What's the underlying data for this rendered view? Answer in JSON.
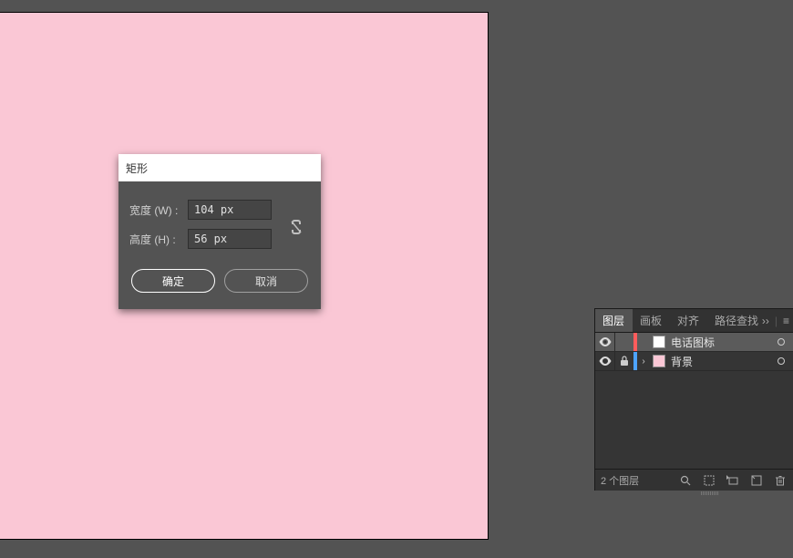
{
  "canvas": {
    "fill": "#fac7d5"
  },
  "dialog": {
    "title": "矩形",
    "width_label": "宽度 (W) :",
    "width_value": "104 px",
    "height_label": "高度 (H) :",
    "height_value": "56 px",
    "ok_label": "确定",
    "cancel_label": "取消"
  },
  "panel": {
    "tabs": [
      "图层",
      "画板",
      "对齐",
      "路径查找"
    ],
    "active_tab": 0,
    "more_glyph": "››",
    "menu_glyph": "≡",
    "layers": [
      {
        "name": "电话图标",
        "color_bar": "#ff5c5c",
        "swatch": "#ffffff",
        "visible": true,
        "locked": false,
        "selected": true,
        "expandable": false
      },
      {
        "name": "背景",
        "color_bar": "#4da3ff",
        "swatch": "#fac7d5",
        "visible": true,
        "locked": true,
        "selected": false,
        "expandable": true
      }
    ],
    "footer_count": "2 个图层"
  }
}
